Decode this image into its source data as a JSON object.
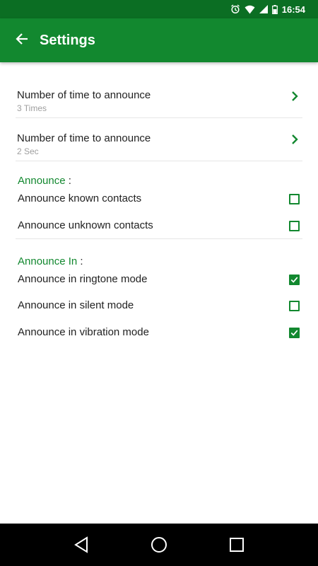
{
  "status_bar": {
    "time": "16:54"
  },
  "app_bar": {
    "title": "Settings"
  },
  "settings": [
    {
      "primary": "Number of time to announce",
      "secondary": "3 Times"
    },
    {
      "primary": "Number of time to announce",
      "secondary": "2 Sec"
    }
  ],
  "announce_section": {
    "title": "Announce",
    "colon": ":",
    "items": [
      {
        "label": "Announce known contacts",
        "checked": false
      },
      {
        "label": "Announce unknown contacts",
        "checked": false
      }
    ]
  },
  "announce_in_section": {
    "title": "Announce In",
    "colon": ":",
    "items": [
      {
        "label": "Announce in ringtone mode",
        "checked": true
      },
      {
        "label": "Announce in silent mode",
        "checked": false
      },
      {
        "label": "Announce in vibration mode",
        "checked": true
      }
    ]
  },
  "colors": {
    "primary": "#12882f",
    "status_bar": "#0b6e23"
  },
  "icons": {
    "status": [
      "alarm-icon",
      "wifi-icon",
      "signal-icon",
      "battery-icon"
    ],
    "app_bar": "arrow-back-icon",
    "nav_bar": [
      "back-triangle-icon",
      "home-circle-icon",
      "recents-square-icon"
    ]
  }
}
